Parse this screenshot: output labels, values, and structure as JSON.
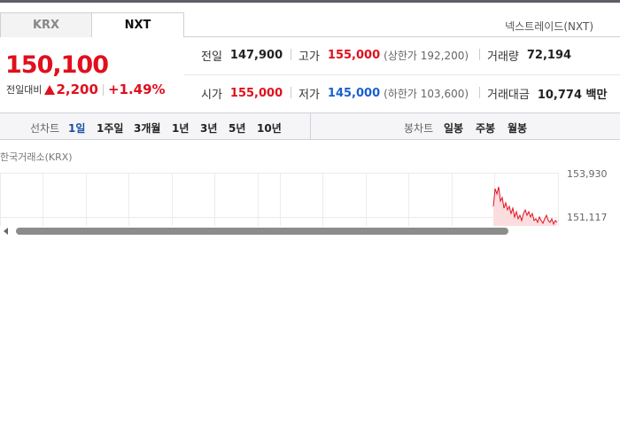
{
  "tabs": [
    {
      "label": "KRX",
      "active": false
    },
    {
      "label": "NXT",
      "active": true
    }
  ],
  "exchange_name": "넥스트레이드(NXT)",
  "price": "150,100",
  "change": {
    "label": "전일대비",
    "value": "2,200",
    "percent": "+1.49%",
    "direction": "up"
  },
  "stats": {
    "prev_close": {
      "label": "전일",
      "value": "147,900"
    },
    "high": {
      "label": "고가",
      "value": "155,000",
      "sub": "(상한가 192,200)"
    },
    "volume": {
      "label": "거래량",
      "value": "72,194"
    },
    "open": {
      "label": "시가",
      "value": "155,000"
    },
    "low": {
      "label": "저가",
      "value": "145,000",
      "sub": "(하한가 103,600)"
    },
    "amount": {
      "label": "거래대금",
      "value": "10,774 백만"
    }
  },
  "toolbar": {
    "line_label": "선차트",
    "line_periods": [
      "1일",
      "1주일",
      "3개월",
      "1년",
      "3년",
      "5년",
      "10년"
    ],
    "selected_period": "1일",
    "candle_label": "봉차트",
    "candle_periods": [
      "일봉",
      "주봉",
      "월봉"
    ]
  },
  "chart_caption": "한국거래소(KRX)",
  "chart_axis": {
    "tick_top": "153,930",
    "tick_mid": "151,117"
  },
  "colors": {
    "up": "#e0101d",
    "down": "#1b5fd0",
    "selected": "#1b4fa0"
  }
}
